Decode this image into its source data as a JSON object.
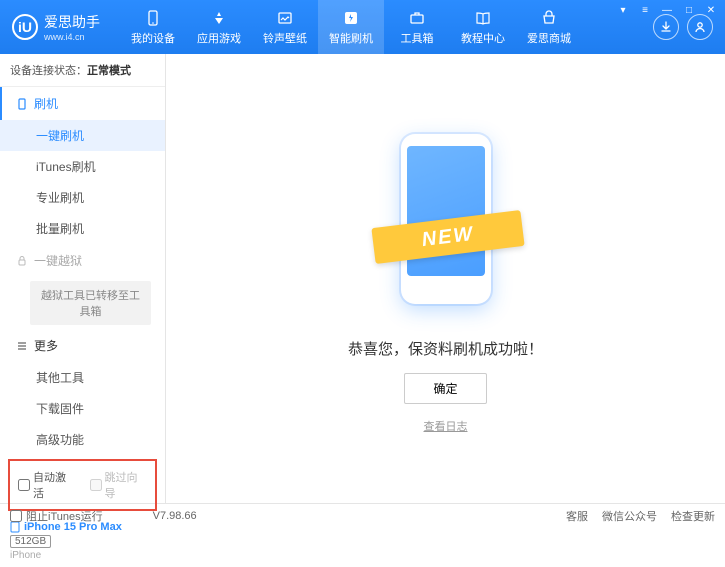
{
  "header": {
    "logo_text": "爱思助手",
    "logo_url": "www.i4.cn",
    "logo_letter": "iU",
    "nav": [
      {
        "label": "我的设备"
      },
      {
        "label": "应用游戏"
      },
      {
        "label": "铃声壁纸"
      },
      {
        "label": "智能刷机"
      },
      {
        "label": "工具箱"
      },
      {
        "label": "教程中心"
      },
      {
        "label": "爱思商城"
      }
    ]
  },
  "sidebar": {
    "status_prefix": "设备连接状态：",
    "status_value": "正常模式",
    "section_flash": "刷机",
    "items_flash": [
      "一键刷机",
      "iTunes刷机",
      "专业刷机",
      "批量刷机"
    ],
    "section_jailbreak": "一键越狱",
    "jailbreak_note": "越狱工具已转移至工具箱",
    "section_more": "更多",
    "items_more": [
      "其他工具",
      "下载固件",
      "高级功能"
    ],
    "checkbox_auto": "自动激活",
    "checkbox_skip": "跳过向导",
    "device_name": "iPhone 15 Pro Max",
    "device_storage": "512GB",
    "device_type": "iPhone"
  },
  "main": {
    "ribbon": "NEW",
    "message": "恭喜您，保资料刷机成功啦！",
    "ok_button": "确定",
    "view_log": "查看日志"
  },
  "footer": {
    "block_itunes": "阻止iTunes运行",
    "version": "V7.98.66",
    "links": [
      "客服",
      "微信公众号",
      "检查更新"
    ]
  }
}
